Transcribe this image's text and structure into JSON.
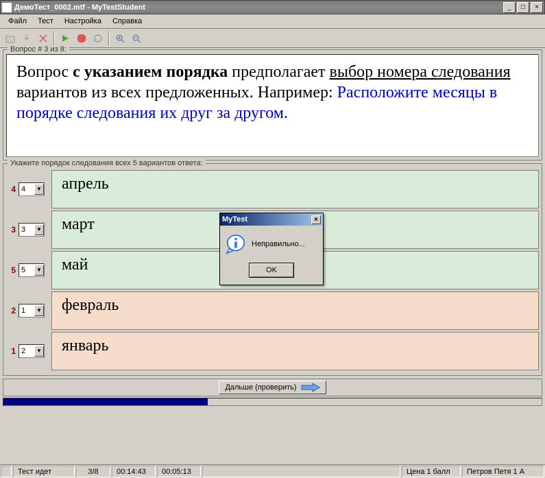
{
  "titlebar": {
    "text": "ДемоТест_0002.mtf - MyTestStudent"
  },
  "menu": {
    "file": "Файл",
    "test": "Тест",
    "settings": "Настройка",
    "help": "Справка"
  },
  "question_header": "Вопрос # 3 из 8:",
  "question": {
    "part1": "Вопрос ",
    "bold1": "с указанием порядка",
    "part2": " предполагает ",
    "u1": "выбор номера следования",
    "part3": " вариантов из всех предложенных. Например: ",
    "blue": "Расположите месяцы в порядке следования их друг за другом."
  },
  "answers_header": "Укажите порядок следования всех 5 вариантов ответа:",
  "answers": [
    {
      "num": "4",
      "sel": "4",
      "text": "апрель",
      "cls": "green"
    },
    {
      "num": "3",
      "sel": "3",
      "text": "март",
      "cls": "green"
    },
    {
      "num": "5",
      "sel": "5",
      "text": "май",
      "cls": "green"
    },
    {
      "num": "2",
      "sel": "1",
      "text": "февраль",
      "cls": "peach"
    },
    {
      "num": "1",
      "sel": "2",
      "text": "январь",
      "cls": "peach"
    }
  ],
  "next_button": "Дальше (проверить)",
  "dialog": {
    "title": "MyTest",
    "message": "Неправильно...",
    "ok": "OK"
  },
  "status": {
    "s0": " ",
    "s1": "Тест идет",
    "s2": "3/8",
    "s3": "00:14:43",
    "s4": "00:05:13",
    "s5": " ",
    "s6": "Цена 1 балл",
    "s7": "Петров Петя 1 А"
  }
}
